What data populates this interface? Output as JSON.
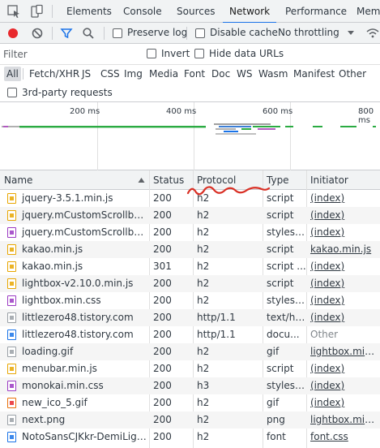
{
  "tabs": [
    {
      "label": "Elements"
    },
    {
      "label": "Console"
    },
    {
      "label": "Sources"
    },
    {
      "label": "Network"
    },
    {
      "label": "Performance"
    },
    {
      "label": "Mem"
    }
  ],
  "toolbar": {
    "preserve_log": "Preserve log",
    "disable_cache": "Disable cache",
    "throttling": "No throttling"
  },
  "filter": {
    "placeholder": "Filter",
    "invert": "Invert",
    "hide_data_urls": "Hide data URLs"
  },
  "types": [
    "All",
    "Fetch/XHR",
    "JS",
    "CSS",
    "Img",
    "Media",
    "Font",
    "Doc",
    "WS",
    "Wasm",
    "Manifest",
    "Other"
  ],
  "third_party": "3rd-party requests",
  "overview": {
    "ticks": [
      "200 ms",
      "400 ms",
      "600 ms",
      "800 ms"
    ]
  },
  "table": {
    "headers": {
      "name": "Name",
      "status": "Status",
      "protocol": "Protocol",
      "type": "Type",
      "initiator": "Initiator"
    },
    "rows": [
      {
        "name": "jquery-3.5.1.min.js",
        "status": "200",
        "protocol": "h2",
        "type": "script",
        "initiator": "(index)",
        "icon": "js",
        "link": true
      },
      {
        "name": "jquery.mCustomScrollbar.c...",
        "status": "200",
        "protocol": "h2",
        "type": "script",
        "initiator": "(index)",
        "icon": "js",
        "link": true
      },
      {
        "name": "jquery.mCustomScrollbar....",
        "status": "200",
        "protocol": "h2",
        "type": "stylesh...",
        "initiator": "(index)",
        "icon": "css",
        "link": true
      },
      {
        "name": "kakao.min.js",
        "status": "200",
        "protocol": "h2",
        "type": "script",
        "initiator": "kakao.min.js",
        "icon": "js",
        "link": true
      },
      {
        "name": "kakao.min.js",
        "status": "301",
        "protocol": "h2",
        "type": "script ...",
        "initiator": "(index)",
        "icon": "js",
        "link": true
      },
      {
        "name": "lightbox-v2.10.0.min.js",
        "status": "200",
        "protocol": "h2",
        "type": "script",
        "initiator": "(index)",
        "icon": "js",
        "link": true
      },
      {
        "name": "lightbox.min.css",
        "status": "200",
        "protocol": "h2",
        "type": "stylesh...",
        "initiator": "(index)",
        "icon": "css",
        "link": true
      },
      {
        "name": "littlezero48.tistory.com",
        "status": "200",
        "protocol": "http/1.1",
        "type": "text/ht...",
        "initiator": "(index)",
        "icon": "doc",
        "link": true
      },
      {
        "name": "littlezero48.tistory.com",
        "status": "200",
        "protocol": "http/1.1",
        "type": "docu...",
        "initiator": "Other",
        "icon": "docblue",
        "link": false
      },
      {
        "name": "loading.gif",
        "status": "200",
        "protocol": "h2",
        "type": "gif",
        "initiator": "lightbox.min....",
        "icon": "img",
        "link": true
      },
      {
        "name": "menubar.min.js",
        "status": "200",
        "protocol": "h2",
        "type": "script",
        "initiator": "(index)",
        "icon": "js",
        "link": true
      },
      {
        "name": "monokai.min.css",
        "status": "200",
        "protocol": "h3",
        "type": "stylesh...",
        "initiator": "(index)",
        "icon": "css",
        "link": true
      },
      {
        "name": "new_ico_5.gif",
        "status": "200",
        "protocol": "h2",
        "type": "gif",
        "initiator": "(index)",
        "icon": "gifred",
        "link": true
      },
      {
        "name": "next.png",
        "status": "200",
        "protocol": "h2",
        "type": "png",
        "initiator": "lightbox.min....",
        "icon": "img",
        "link": true
      },
      {
        "name": "NotoSansCJKkr-DemiLight....",
        "status": "200",
        "protocol": "h2",
        "type": "font",
        "initiator": "font.css",
        "icon": "font",
        "link": true
      }
    ]
  },
  "colors": {
    "accent": "#1a73e8",
    "record": "#e8292d",
    "annotation": "#d93025"
  }
}
